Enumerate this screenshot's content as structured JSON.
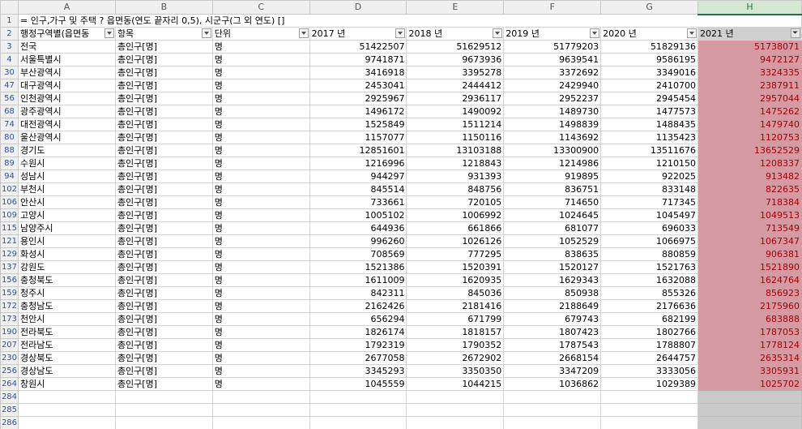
{
  "columns": [
    "A",
    "B",
    "C",
    "D",
    "E",
    "F",
    "G",
    "H"
  ],
  "title_row": {
    "row": "1",
    "text": "= 인구,가구 및 주택 ? 읍면동(연도 끝자리 0,5), 시군구(그 외 연도) []"
  },
  "header_row": {
    "row": "2",
    "cells": [
      "행정구역별(읍면동",
      "항목",
      "단위",
      "2017 년",
      "2018 년",
      "2019 년",
      "2020 년",
      "2021 년"
    ]
  },
  "rows": [
    {
      "row": "3",
      "region": "전국",
      "item": "총인구[명]",
      "unit": "명",
      "y2017": "51422507",
      "y2018": "51629512",
      "y2019": "51779203",
      "y2020": "51829136",
      "y2021": "51738071"
    },
    {
      "row": "4",
      "region": "서울특별시",
      "item": "총인구[명]",
      "unit": "명",
      "y2017": "9741871",
      "y2018": "9673936",
      "y2019": "9639541",
      "y2020": "9586195",
      "y2021": "9472127"
    },
    {
      "row": "30",
      "region": "부산광역시",
      "item": "총인구[명]",
      "unit": "명",
      "y2017": "3416918",
      "y2018": "3395278",
      "y2019": "3372692",
      "y2020": "3349016",
      "y2021": "3324335"
    },
    {
      "row": "47",
      "region": "대구광역시",
      "item": "총인구[명]",
      "unit": "명",
      "y2017": "2453041",
      "y2018": "2444412",
      "y2019": "2429940",
      "y2020": "2410700",
      "y2021": "2387911"
    },
    {
      "row": "56",
      "region": "인천광역시",
      "item": "총인구[명]",
      "unit": "명",
      "y2017": "2925967",
      "y2018": "2936117",
      "y2019": "2952237",
      "y2020": "2945454",
      "y2021": "2957044"
    },
    {
      "row": "68",
      "region": "광주광역시",
      "item": "총인구[명]",
      "unit": "명",
      "y2017": "1496172",
      "y2018": "1490092",
      "y2019": "1489730",
      "y2020": "1477573",
      "y2021": "1475262"
    },
    {
      "row": "74",
      "region": "대전광역시",
      "item": "총인구[명]",
      "unit": "명",
      "y2017": "1525849",
      "y2018": "1511214",
      "y2019": "1498839",
      "y2020": "1488435",
      "y2021": "1479740"
    },
    {
      "row": "80",
      "region": "울산광역시",
      "item": "총인구[명]",
      "unit": "명",
      "y2017": "1157077",
      "y2018": "1150116",
      "y2019": "1143692",
      "y2020": "1135423",
      "y2021": "1120753"
    },
    {
      "row": "88",
      "region": "경기도",
      "item": "총인구[명]",
      "unit": "명",
      "y2017": "12851601",
      "y2018": "13103188",
      "y2019": "13300900",
      "y2020": "13511676",
      "y2021": "13652529"
    },
    {
      "row": "89",
      "region": "수원시",
      "item": "총인구[명]",
      "unit": "명",
      "y2017": "1216996",
      "y2018": "1218843",
      "y2019": "1214986",
      "y2020": "1210150",
      "y2021": "1208337"
    },
    {
      "row": "94",
      "region": "성남시",
      "item": "총인구[명]",
      "unit": "명",
      "y2017": "944297",
      "y2018": "931393",
      "y2019": "919895",
      "y2020": "922025",
      "y2021": "913482"
    },
    {
      "row": "102",
      "region": "부천시",
      "item": "총인구[명]",
      "unit": "명",
      "y2017": "845514",
      "y2018": "848756",
      "y2019": "836751",
      "y2020": "833148",
      "y2021": "822635"
    },
    {
      "row": "106",
      "region": "안산시",
      "item": "총인구[명]",
      "unit": "명",
      "y2017": "733661",
      "y2018": "720105",
      "y2019": "714650",
      "y2020": "717345",
      "y2021": "718384"
    },
    {
      "row": "109",
      "region": "고양시",
      "item": "총인구[명]",
      "unit": "명",
      "y2017": "1005102",
      "y2018": "1006992",
      "y2019": "1024645",
      "y2020": "1045497",
      "y2021": "1049513"
    },
    {
      "row": "115",
      "region": "남양주시",
      "item": "총인구[명]",
      "unit": "명",
      "y2017": "644936",
      "y2018": "661866",
      "y2019": "681077",
      "y2020": "696033",
      "y2021": "713549"
    },
    {
      "row": "121",
      "region": "용인시",
      "item": "총인구[명]",
      "unit": "명",
      "y2017": "996260",
      "y2018": "1026126",
      "y2019": "1052529",
      "y2020": "1066975",
      "y2021": "1067347"
    },
    {
      "row": "129",
      "region": "화성시",
      "item": "총인구[명]",
      "unit": "명",
      "y2017": "708569",
      "y2018": "777295",
      "y2019": "838635",
      "y2020": "880859",
      "y2021": "906381"
    },
    {
      "row": "137",
      "region": "강원도",
      "item": "총인구[명]",
      "unit": "명",
      "y2017": "1521386",
      "y2018": "1520391",
      "y2019": "1520127",
      "y2020": "1521763",
      "y2021": "1521890"
    },
    {
      "row": "156",
      "region": "충청북도",
      "item": "총인구[명]",
      "unit": "명",
      "y2017": "1611009",
      "y2018": "1620935",
      "y2019": "1629343",
      "y2020": "1632088",
      "y2021": "1624764"
    },
    {
      "row": "159",
      "region": "청주시",
      "item": "총인구[명]",
      "unit": "명",
      "y2017": "842311",
      "y2018": "845036",
      "y2019": "850938",
      "y2020": "855326",
      "y2021": "856923"
    },
    {
      "row": "172",
      "region": "충청남도",
      "item": "총인구[명]",
      "unit": "명",
      "y2017": "2162426",
      "y2018": "2181416",
      "y2019": "2188649",
      "y2020": "2176636",
      "y2021": "2175960"
    },
    {
      "row": "173",
      "region": "천안시",
      "item": "총인구[명]",
      "unit": "명",
      "y2017": "656294",
      "y2018": "671799",
      "y2019": "679743",
      "y2020": "682199",
      "y2021": "683888"
    },
    {
      "row": "190",
      "region": "전라북도",
      "item": "총인구[명]",
      "unit": "명",
      "y2017": "1826174",
      "y2018": "1818157",
      "y2019": "1807423",
      "y2020": "1802766",
      "y2021": "1787053"
    },
    {
      "row": "207",
      "region": "전라남도",
      "item": "총인구[명]",
      "unit": "명",
      "y2017": "1792319",
      "y2018": "1790352",
      "y2019": "1787543",
      "y2020": "1788807",
      "y2021": "1778124"
    },
    {
      "row": "230",
      "region": "경상북도",
      "item": "총인구[명]",
      "unit": "명",
      "y2017": "2677058",
      "y2018": "2672902",
      "y2019": "2668154",
      "y2020": "2644757",
      "y2021": "2635314"
    },
    {
      "row": "256",
      "region": "경상남도",
      "item": "총인구[명]",
      "unit": "명",
      "y2017": "3345293",
      "y2018": "3350350",
      "y2019": "3347209",
      "y2020": "3333056",
      "y2021": "3305931"
    },
    {
      "row": "264",
      "region": "창원시",
      "item": "총인구[명]",
      "unit": "명",
      "y2017": "1045559",
      "y2018": "1044215",
      "y2019": "1036862",
      "y2020": "1029389",
      "y2021": "1025702"
    }
  ],
  "empty_rows": [
    "284",
    "285",
    "286"
  ],
  "colors": {
    "highlight_fill": "#d59aa2",
    "highlight_text": "#9c0006",
    "selected_header": "#217346",
    "row_number": "#2b4fb0"
  }
}
